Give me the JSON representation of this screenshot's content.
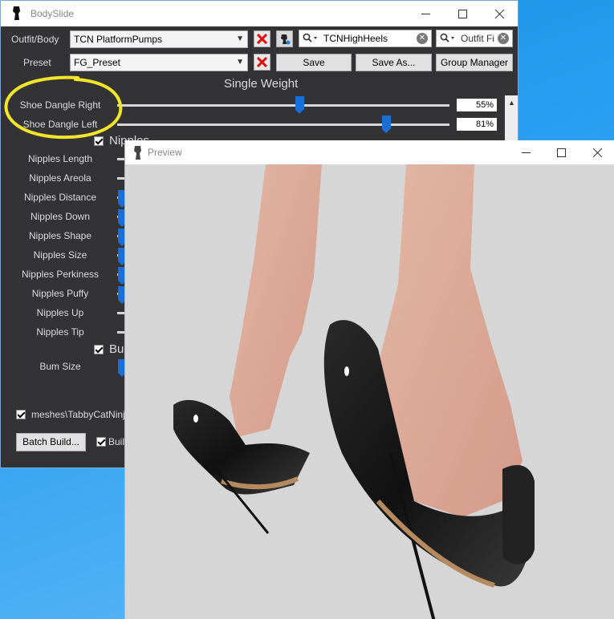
{
  "main": {
    "title": "BodySlide",
    "outfit_label": "Outfit/Body",
    "outfit_value": "TCN PlatformPumps",
    "preset_label": "Preset",
    "preset_value": "FG_Preset",
    "save": "Save",
    "save_as": "Save As...",
    "group_manager": "Group Manager",
    "search_value": "TCNHighHeels",
    "outfit_filter": "Outfit Fi",
    "heading": "Single Weight"
  },
  "sliders": [
    {
      "label": "Shoe Dangle Right",
      "value": "55%",
      "fraction": 0.55
    },
    {
      "label": "Shoe Dangle Left",
      "value": "81%",
      "fraction": 0.81
    }
  ],
  "groups": {
    "nipples": "Nipples",
    "butt": "Bu"
  },
  "nipple_sliders": [
    {
      "label": "Nipples Length",
      "blue": false
    },
    {
      "label": "Nipples Areola",
      "blue": false
    },
    {
      "label": "Nipples Distance",
      "blue": true
    },
    {
      "label": "Nipples Down",
      "blue": true
    },
    {
      "label": "Nipples Shape",
      "blue": true
    },
    {
      "label": "Nipples Size",
      "blue": true
    },
    {
      "label": "Nipples Perkiness",
      "blue": true
    },
    {
      "label": "Nipples Puffy",
      "blue": true
    },
    {
      "label": "Nipples Up",
      "blue": false
    },
    {
      "label": "Nipples Tip",
      "blue": false
    }
  ],
  "bum_slider": {
    "label": "Bum Size"
  },
  "bottom": {
    "output_path": "meshes\\TabbyCatNinj",
    "batch_build": "Batch Build...",
    "build_checkbox": "Buil"
  },
  "preview": {
    "title": "Preview"
  },
  "colors": {
    "accent": "#1a6ed8",
    "window_bg": "#333335",
    "annotation": "#f2e52a",
    "close_x": "#e01010"
  }
}
